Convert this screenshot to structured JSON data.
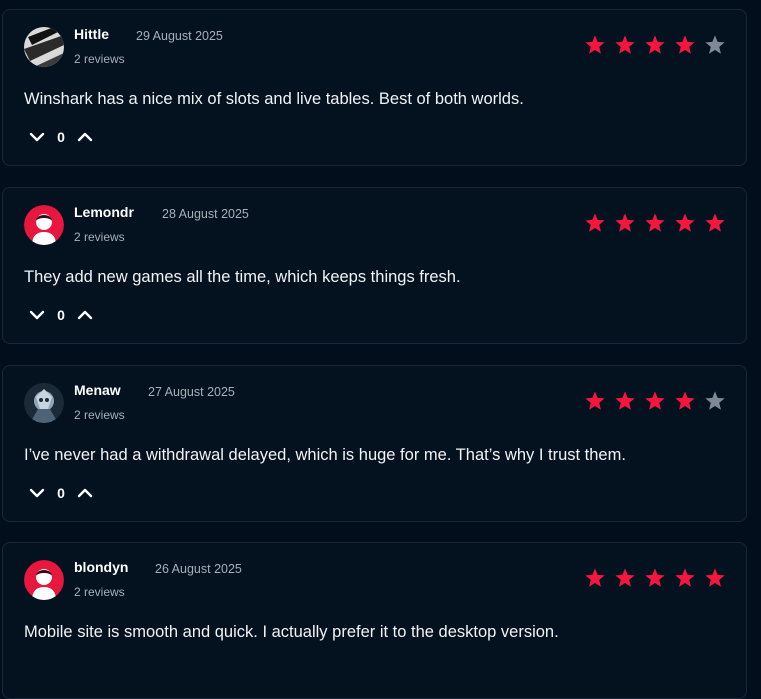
{
  "colors": {
    "star_filled": "#f5163f",
    "star_empty": "#7e8994",
    "card_bg": "#04111f",
    "page_bg": "#020e1c",
    "avatar_red": "#e7173f"
  },
  "reviews": [
    {
      "author": "Hittle",
      "date": "29 August 2025",
      "review_count": "2 reviews",
      "rating": 4,
      "text": "Winshark has a nice mix of slots and live tables. Best of both worlds.",
      "votes": "0",
      "avatar": "photo-avatar"
    },
    {
      "author": "Lemondr",
      "date": "28 August 2025",
      "review_count": "2 reviews",
      "rating": 5,
      "text": "They add new games all the time, which keeps things fresh.",
      "votes": "0",
      "avatar": "default-user-avatar"
    },
    {
      "author": "Menaw",
      "date": "27 August 2025",
      "review_count": "2 reviews",
      "rating": 4,
      "text": "I’ve never had a withdrawal delayed, which is huge for me. That’s why I trust them.",
      "votes": "0",
      "avatar": "photo-avatar"
    },
    {
      "author": "blondyn",
      "date": "26 August 2025",
      "review_count": "2 reviews",
      "rating": 5,
      "text": "Mobile site is smooth and quick. I actually prefer it to the desktop version.",
      "votes": "",
      "avatar": "default-user-avatar"
    }
  ]
}
